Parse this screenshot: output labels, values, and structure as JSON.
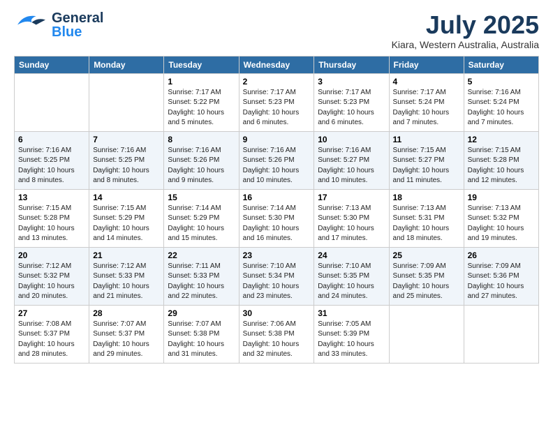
{
  "header": {
    "logo": {
      "line1": "General",
      "line2": "Blue"
    },
    "month": "July 2025",
    "location": "Kiara, Western Australia, Australia"
  },
  "days_of_week": [
    "Sunday",
    "Monday",
    "Tuesday",
    "Wednesday",
    "Thursday",
    "Friday",
    "Saturday"
  ],
  "weeks": [
    [
      {
        "day": "",
        "info": ""
      },
      {
        "day": "",
        "info": ""
      },
      {
        "day": "1",
        "info": "Sunrise: 7:17 AM\nSunset: 5:22 PM\nDaylight: 10 hours\nand 5 minutes."
      },
      {
        "day": "2",
        "info": "Sunrise: 7:17 AM\nSunset: 5:23 PM\nDaylight: 10 hours\nand 6 minutes."
      },
      {
        "day": "3",
        "info": "Sunrise: 7:17 AM\nSunset: 5:23 PM\nDaylight: 10 hours\nand 6 minutes."
      },
      {
        "day": "4",
        "info": "Sunrise: 7:17 AM\nSunset: 5:24 PM\nDaylight: 10 hours\nand 7 minutes."
      },
      {
        "day": "5",
        "info": "Sunrise: 7:16 AM\nSunset: 5:24 PM\nDaylight: 10 hours\nand 7 minutes."
      }
    ],
    [
      {
        "day": "6",
        "info": "Sunrise: 7:16 AM\nSunset: 5:25 PM\nDaylight: 10 hours\nand 8 minutes."
      },
      {
        "day": "7",
        "info": "Sunrise: 7:16 AM\nSunset: 5:25 PM\nDaylight: 10 hours\nand 8 minutes."
      },
      {
        "day": "8",
        "info": "Sunrise: 7:16 AM\nSunset: 5:26 PM\nDaylight: 10 hours\nand 9 minutes."
      },
      {
        "day": "9",
        "info": "Sunrise: 7:16 AM\nSunset: 5:26 PM\nDaylight: 10 hours\nand 10 minutes."
      },
      {
        "day": "10",
        "info": "Sunrise: 7:16 AM\nSunset: 5:27 PM\nDaylight: 10 hours\nand 10 minutes."
      },
      {
        "day": "11",
        "info": "Sunrise: 7:15 AM\nSunset: 5:27 PM\nDaylight: 10 hours\nand 11 minutes."
      },
      {
        "day": "12",
        "info": "Sunrise: 7:15 AM\nSunset: 5:28 PM\nDaylight: 10 hours\nand 12 minutes."
      }
    ],
    [
      {
        "day": "13",
        "info": "Sunrise: 7:15 AM\nSunset: 5:28 PM\nDaylight: 10 hours\nand 13 minutes."
      },
      {
        "day": "14",
        "info": "Sunrise: 7:15 AM\nSunset: 5:29 PM\nDaylight: 10 hours\nand 14 minutes."
      },
      {
        "day": "15",
        "info": "Sunrise: 7:14 AM\nSunset: 5:29 PM\nDaylight: 10 hours\nand 15 minutes."
      },
      {
        "day": "16",
        "info": "Sunrise: 7:14 AM\nSunset: 5:30 PM\nDaylight: 10 hours\nand 16 minutes."
      },
      {
        "day": "17",
        "info": "Sunrise: 7:13 AM\nSunset: 5:30 PM\nDaylight: 10 hours\nand 17 minutes."
      },
      {
        "day": "18",
        "info": "Sunrise: 7:13 AM\nSunset: 5:31 PM\nDaylight: 10 hours\nand 18 minutes."
      },
      {
        "day": "19",
        "info": "Sunrise: 7:13 AM\nSunset: 5:32 PM\nDaylight: 10 hours\nand 19 minutes."
      }
    ],
    [
      {
        "day": "20",
        "info": "Sunrise: 7:12 AM\nSunset: 5:32 PM\nDaylight: 10 hours\nand 20 minutes."
      },
      {
        "day": "21",
        "info": "Sunrise: 7:12 AM\nSunset: 5:33 PM\nDaylight: 10 hours\nand 21 minutes."
      },
      {
        "day": "22",
        "info": "Sunrise: 7:11 AM\nSunset: 5:33 PM\nDaylight: 10 hours\nand 22 minutes."
      },
      {
        "day": "23",
        "info": "Sunrise: 7:10 AM\nSunset: 5:34 PM\nDaylight: 10 hours\nand 23 minutes."
      },
      {
        "day": "24",
        "info": "Sunrise: 7:10 AM\nSunset: 5:35 PM\nDaylight: 10 hours\nand 24 minutes."
      },
      {
        "day": "25",
        "info": "Sunrise: 7:09 AM\nSunset: 5:35 PM\nDaylight: 10 hours\nand 25 minutes."
      },
      {
        "day": "26",
        "info": "Sunrise: 7:09 AM\nSunset: 5:36 PM\nDaylight: 10 hours\nand 27 minutes."
      }
    ],
    [
      {
        "day": "27",
        "info": "Sunrise: 7:08 AM\nSunset: 5:37 PM\nDaylight: 10 hours\nand 28 minutes."
      },
      {
        "day": "28",
        "info": "Sunrise: 7:07 AM\nSunset: 5:37 PM\nDaylight: 10 hours\nand 29 minutes."
      },
      {
        "day": "29",
        "info": "Sunrise: 7:07 AM\nSunset: 5:38 PM\nDaylight: 10 hours\nand 31 minutes."
      },
      {
        "day": "30",
        "info": "Sunrise: 7:06 AM\nSunset: 5:38 PM\nDaylight: 10 hours\nand 32 minutes."
      },
      {
        "day": "31",
        "info": "Sunrise: 7:05 AM\nSunset: 5:39 PM\nDaylight: 10 hours\nand 33 minutes."
      },
      {
        "day": "",
        "info": ""
      },
      {
        "day": "",
        "info": ""
      }
    ]
  ]
}
